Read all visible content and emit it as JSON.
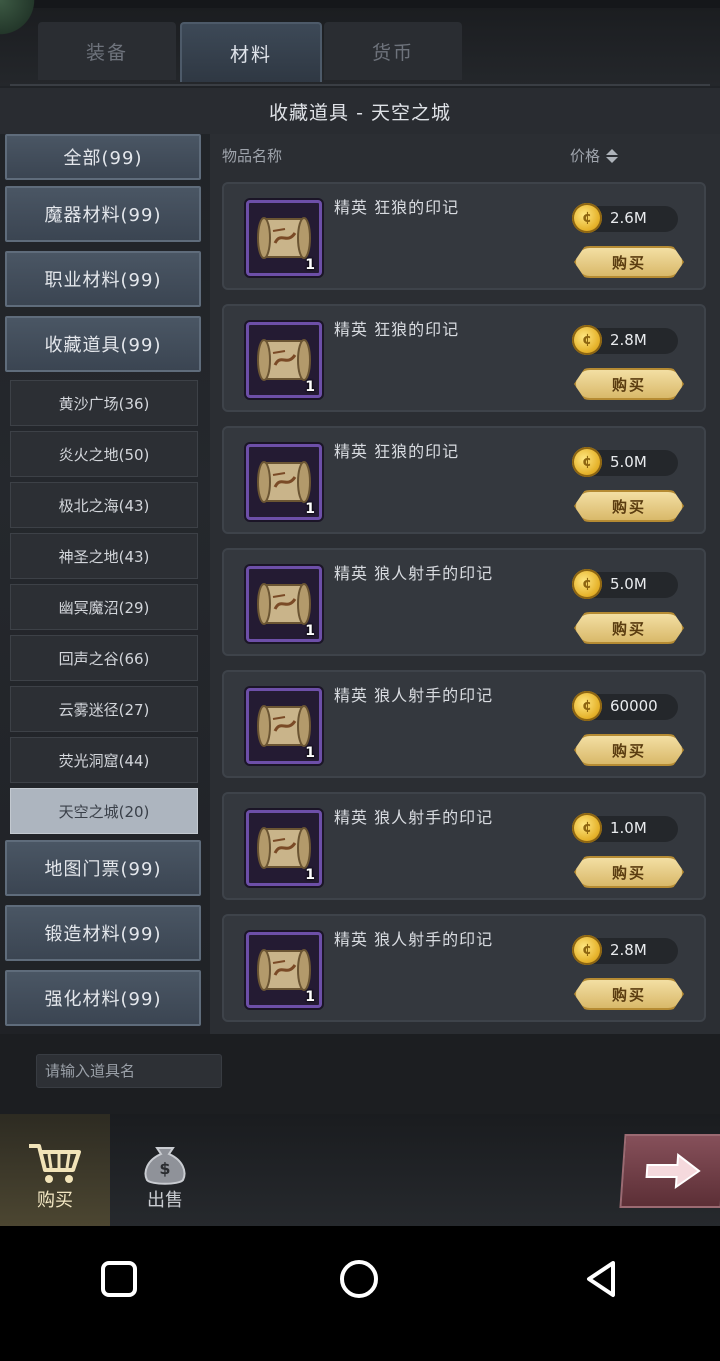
{
  "tabs": [
    "装备",
    "材料",
    "货币"
  ],
  "active_tab": "材料",
  "title": "收藏道具 - 天空之城",
  "categories_top": [
    {
      "label": "全部(99)"
    },
    {
      "label": "魔器材料(99)"
    },
    {
      "label": "职业材料(99)"
    },
    {
      "label": "收藏道具(99)"
    }
  ],
  "subcategories": [
    {
      "label": "黄沙广场(36)"
    },
    {
      "label": "炎火之地(50)"
    },
    {
      "label": "极北之海(43)"
    },
    {
      "label": "神圣之地(43)"
    },
    {
      "label": "幽冥魔沼(29)"
    },
    {
      "label": "回声之谷(66)"
    },
    {
      "label": "云雾迷径(27)"
    },
    {
      "label": "荧光洞窟(44)"
    },
    {
      "label": "天空之城(20)"
    }
  ],
  "selected_subcategory": "天空之城(20)",
  "categories_bottom": [
    {
      "label": "地图门票(99)"
    },
    {
      "label": "锻造材料(99)"
    },
    {
      "label": "强化材料(99)"
    }
  ],
  "list_header": {
    "name": "物品名称",
    "price": "价格"
  },
  "items": [
    {
      "name": "精英 狂狼的印记",
      "qty": "1",
      "price": "2.6M",
      "buy": "购买"
    },
    {
      "name": "精英 狂狼的印记",
      "qty": "1",
      "price": "2.8M",
      "buy": "购买"
    },
    {
      "name": "精英 狂狼的印记",
      "qty": "1",
      "price": "5.0M",
      "buy": "购买"
    },
    {
      "name": "精英 狼人射手的印记",
      "qty": "1",
      "price": "5.0M",
      "buy": "购买"
    },
    {
      "name": "精英 狼人射手的印记",
      "qty": "1",
      "price": "60000",
      "buy": "购买"
    },
    {
      "name": "精英 狼人射手的印记",
      "qty": "1",
      "price": "1.0M",
      "buy": "购买"
    },
    {
      "name": "精英 狼人射手的印记",
      "qty": "1",
      "price": "2.8M",
      "buy": "购买"
    }
  ],
  "search": {
    "placeholder": "请输入道具名"
  },
  "bottom_tabs": [
    {
      "label": "购买",
      "icon": "cart-icon"
    },
    {
      "label": "出售",
      "icon": "money-bag-icon"
    }
  ],
  "colors": {
    "accent_gold": "#d9b96a",
    "item_border": "#6d4fa8",
    "selected_sub": "#adb5bf"
  }
}
